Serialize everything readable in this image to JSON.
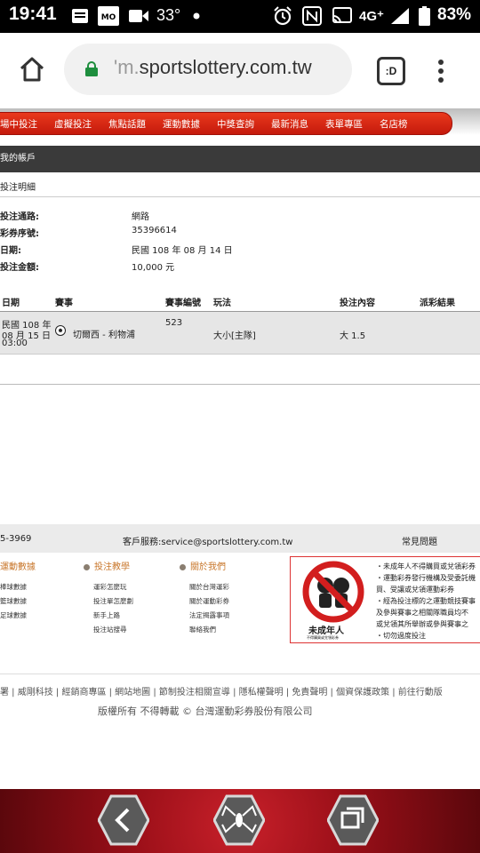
{
  "status_bar": {
    "time": "19:41",
    "temperature": "33°",
    "network": "4G⁺",
    "battery": "83%"
  },
  "browser": {
    "url_prefix": "'m.",
    "url_main": "sportslottery.com.tw",
    "tabs_label": ":D"
  },
  "nav": {
    "items": [
      "場中投注",
      "虛擬投注",
      "焦點話題",
      "運動數據",
      "中獎查詢",
      "最新消息",
      "表單專區",
      "名店榜"
    ]
  },
  "account": {
    "bar_title": "我的帳戶",
    "section_title": "投注明細"
  },
  "info": {
    "channel_label": "投注通路:",
    "channel_value": "網路",
    "ticket_label": "彩券序號:",
    "ticket_value": "35396614",
    "date_label": "日期:",
    "date_value": "民國 108 年 08 月 14 日",
    "amount_label": "投注金額:",
    "amount_value": "10,000 元"
  },
  "table": {
    "headers": [
      "日期",
      "賽事",
      "賽事編號",
      "玩法",
      "投注內容",
      "派彩結果"
    ],
    "row": {
      "date_line1": "民國 108 年",
      "date_line2": "08 月 15 日",
      "date_line3": "03:00",
      "match": "切爾西 - 利物浦",
      "match_no": "523",
      "play": "大小[主隊]",
      "bet": "大 1.5",
      "result": ""
    }
  },
  "footer": {
    "phone": "5-3969",
    "service": "客戶服務:service@sportslottery.com.tw",
    "faq": "常見問題",
    "col1_title": "運動數據",
    "col1_links": [
      "棒球數據",
      "籃球數據",
      "足球數據"
    ],
    "col2_title": "投注教學",
    "col2_links": [
      "運彩怎麼玩",
      "投注單怎麼劃",
      "新手上路",
      "投注站搜尋"
    ],
    "col3_title": "關於我們",
    "col3_links": [
      "關於台灣運彩",
      "關於運動彩券",
      "法定揭露事項",
      "聯絡我們"
    ],
    "warning_caption": "未成年人",
    "warning_small": "不得購買或兌領彩券",
    "warning_lines": [
      "・未成年人不得購買或兌領彩券",
      "・運動彩券發行機構及受委託機",
      "  買、受讓或兌領運動彩券",
      "・經為投注標的之運動競技賽事",
      "  及參與賽事之相關隊職員均不",
      "  或兌領其所舉辦或參與賽事之",
      "・切勿過度投注"
    ],
    "links_line": "署 | 威剛科技 | 經銷商專區 | 網站地圖 | 節制投注相關宣導 | 隱私權聲明 | 免責聲明 | 個資保護政策 | 前往行動版",
    "copyright": "版權所有 不得轉載 © 台灣運動彩券股份有限公司"
  },
  "colors": {
    "nav_red": "#d42a14",
    "account_bar": "#3a3a3a",
    "footer_accent": "#c8762a"
  }
}
